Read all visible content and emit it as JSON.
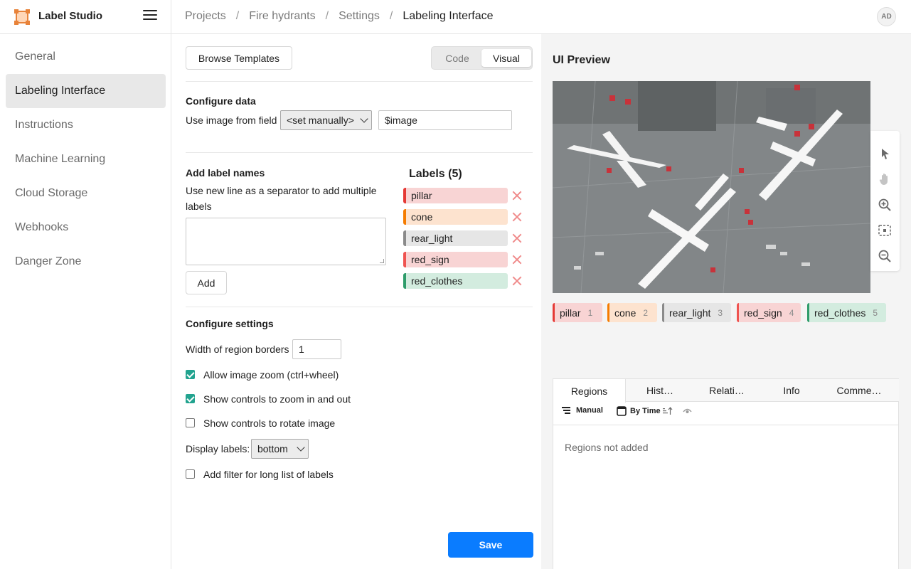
{
  "app": {
    "name": "Label Studio",
    "avatar_initials": "AD"
  },
  "breadcrumbs": [
    "Projects",
    "Fire hydrants",
    "Settings",
    "Labeling Interface"
  ],
  "sidebar": {
    "items": [
      {
        "label": "General",
        "active": false
      },
      {
        "label": "Labeling Interface",
        "active": true
      },
      {
        "label": "Instructions",
        "active": false
      },
      {
        "label": "Machine Learning",
        "active": false
      },
      {
        "label": "Cloud Storage",
        "active": false
      },
      {
        "label": "Webhooks",
        "active": false
      },
      {
        "label": "Danger Zone",
        "active": false
      }
    ]
  },
  "config": {
    "browse_templates_label": "Browse Templates",
    "mode_tabs": {
      "code": "Code",
      "visual": "Visual",
      "selected": "Visual"
    },
    "configure_data": {
      "title": "Configure data",
      "field_label": "Use image from field",
      "field_select_value": "<set manually>",
      "field_input_value": "$image"
    },
    "add_labels": {
      "title": "Add label names",
      "hint": "Use new line as a separator to add multiple labels",
      "textarea_value": "",
      "add_button": "Add"
    },
    "labels_title": "Labels (5)",
    "labels": [
      {
        "name": "pillar",
        "color": "#e53935",
        "bg": "#f8d4d4"
      },
      {
        "name": "cone",
        "color": "#f57c00",
        "bg": "#fde3cf"
      },
      {
        "name": "rear_light",
        "color": "#8a8a8a",
        "bg": "#e6e6e6"
      },
      {
        "name": "red_sign",
        "color": "#ef5350",
        "bg": "#f8d4d4"
      },
      {
        "name": "red_clothes",
        "color": "#2e9c6a",
        "bg": "#d3ecdf"
      }
    ],
    "settings": {
      "title": "Configure settings",
      "border_width_label": "Width of region borders",
      "border_width_value": "1",
      "zoom_label": "Allow image zoom (ctrl+wheel)",
      "zoom_checked": true,
      "zoom_controls_label": "Show controls to zoom in and out",
      "zoom_controls_checked": true,
      "rotate_label": "Show controls to rotate image",
      "rotate_checked": false,
      "display_labels_label": "Display labels:",
      "display_labels_value": "bottom",
      "filter_label": "Add filter for long list of labels",
      "filter_checked": false
    },
    "save_button": "Save"
  },
  "preview": {
    "title": "UI Preview",
    "image_icon": "airport-aerial-photo",
    "tools": [
      "cursor-icon",
      "hand-pan-icon",
      "zoom-in-icon",
      "fit-to-screen-icon",
      "zoom-out-icon"
    ],
    "labels": [
      {
        "name": "pillar",
        "hotkey": "1",
        "color": "#e53935",
        "bg": "#f8d4d4"
      },
      {
        "name": "cone",
        "hotkey": "2",
        "color": "#f57c00",
        "bg": "#fde3cf"
      },
      {
        "name": "rear_light",
        "hotkey": "3",
        "color": "#8a8a8a",
        "bg": "#e6e6e6"
      },
      {
        "name": "red_sign",
        "hotkey": "4",
        "color": "#ef5350",
        "bg": "#f8d4d4"
      },
      {
        "name": "red_clothes",
        "hotkey": "5",
        "color": "#2e9c6a",
        "bg": "#d3ecdf"
      }
    ],
    "tabs": [
      "Regions",
      "Hist…",
      "Relati…",
      "Info",
      "Comme…"
    ],
    "active_tab": "Regions",
    "region_tools": {
      "manual": "Manual",
      "by_time": "By Time"
    },
    "empty_message": "Regions not added"
  }
}
